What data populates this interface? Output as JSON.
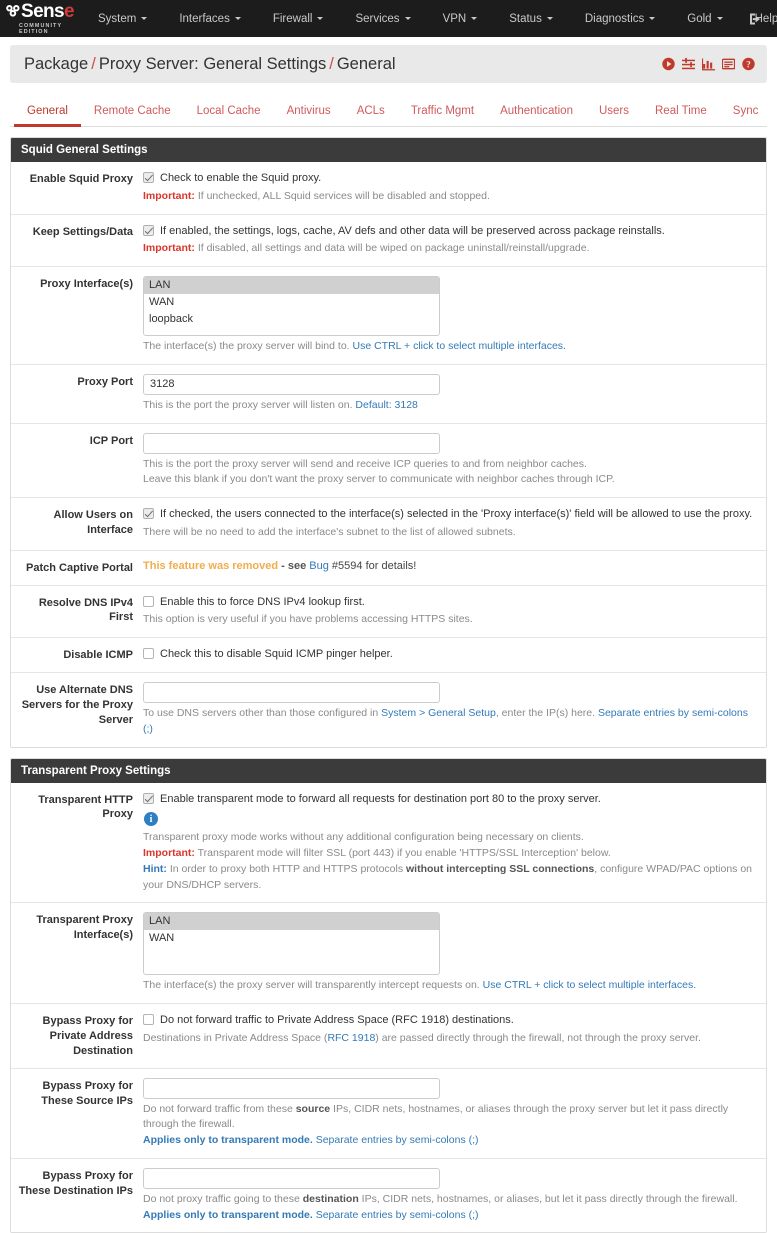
{
  "brand": {
    "name_pf": "pf",
    "name_sens": "Sens",
    "name_e": "e",
    "subtitle": "COMMUNITY EDITION"
  },
  "navbar": {
    "items": [
      {
        "label": "System",
        "has_caret": true
      },
      {
        "label": "Interfaces",
        "has_caret": true
      },
      {
        "label": "Firewall",
        "has_caret": true
      },
      {
        "label": "Services",
        "has_caret": true
      },
      {
        "label": "VPN",
        "has_caret": true
      },
      {
        "label": "Status",
        "has_caret": true
      },
      {
        "label": "Diagnostics",
        "has_caret": true
      },
      {
        "label": "Gold",
        "has_caret": true
      },
      {
        "label": "Help",
        "has_caret": true
      }
    ],
    "logout_icon": "logout-icon"
  },
  "breadcrumb": {
    "part1": "Package",
    "part2": "Proxy Server: General Settings",
    "part3": "General",
    "sep": "/",
    "icons": [
      "play-icon",
      "sliders-icon",
      "chart-icon",
      "log-icon",
      "help-icon"
    ]
  },
  "tabs": [
    {
      "label": "General",
      "active": true
    },
    {
      "label": "Remote Cache",
      "active": false
    },
    {
      "label": "Local Cache",
      "active": false
    },
    {
      "label": "Antivirus",
      "active": false
    },
    {
      "label": "ACLs",
      "active": false
    },
    {
      "label": "Traffic Mgmt",
      "active": false
    },
    {
      "label": "Authentication",
      "active": false
    },
    {
      "label": "Users",
      "active": false
    },
    {
      "label": "Real Time",
      "active": false
    },
    {
      "label": "Sync",
      "active": false
    }
  ],
  "squid_general": {
    "title": "Squid General Settings",
    "enable_squid": {
      "label": "Enable Squid Proxy",
      "checkbox_text": "Check to enable the Squid proxy.",
      "checked": true,
      "important_label": "Important:",
      "important_text": " If unchecked, ALL Squid services will be disabled and stopped."
    },
    "keep_settings": {
      "label": "Keep Settings/Data",
      "checkbox_text": "If enabled, the settings, logs, cache, AV defs and other data will be preserved across package reinstalls.",
      "checked": true,
      "important_label": "Important:",
      "important_text": " If disabled, all settings and data will be wiped on package uninstall/reinstall/upgrade."
    },
    "proxy_interfaces": {
      "label": "Proxy Interface(s)",
      "options": [
        {
          "value": "LAN",
          "selected": true
        },
        {
          "value": "WAN",
          "selected": false
        },
        {
          "value": "loopback",
          "selected": false
        }
      ],
      "help_text": "The interface(s) the proxy server will bind to. ",
      "help_link": "Use CTRL + click to select multiple interfaces."
    },
    "proxy_port": {
      "label": "Proxy Port",
      "value": "3128",
      "placeholder": "",
      "help_text": "This is the port the proxy server will listen on. ",
      "help_link": "Default: 3128"
    },
    "icp_port": {
      "label": "ICP Port",
      "value": "",
      "placeholder": "",
      "help_line1": "This is the port the proxy server will send and receive ICP queries to and from neighbor caches.",
      "help_line2": "Leave this blank if you don't want the proxy server to communicate with neighbor caches through ICP."
    },
    "allow_users": {
      "label": "Allow Users on Interface",
      "checkbox_text": "If checked, the users connected to the interface(s) selected in the 'Proxy interface(s)' field will be allowed to use the proxy.",
      "checked": true,
      "help_text": "There will be no need to add the interface's subnet to the list of allowed subnets."
    },
    "patch_captive_portal": {
      "label": "Patch Captive Portal",
      "warning": "This feature was removed",
      "mid": " - see ",
      "link": "Bug",
      "tail": " #5594 for details!"
    },
    "resolve_dns_ipv4": {
      "label": "Resolve DNS IPv4 First",
      "checkbox_text": "Enable this to force DNS IPv4 lookup first.",
      "checked": false,
      "help_text": "This option is very useful if you have problems accessing HTTPS sites."
    },
    "disable_icmp": {
      "label": "Disable ICMP",
      "checkbox_text": "Check this to disable Squid ICMP pinger helper.",
      "checked": false
    },
    "alternate_dns": {
      "label": "Use Alternate DNS Servers for the Proxy Server",
      "value": "",
      "placeholder": "",
      "help_pre": "To use DNS servers other than those configured in ",
      "help_link1": "System > General Setup",
      "help_mid": ", enter the IP(s) here. ",
      "help_link2": "Separate entries by semi-colons (;)"
    }
  },
  "transparent_proxy": {
    "title": "Transparent Proxy Settings",
    "transparent_http": {
      "label": "Transparent HTTP Proxy",
      "checkbox_text": "Enable transparent mode to forward all requests for destination port 80 to the proxy server.",
      "checked": true,
      "info_icon": "info-icon",
      "help_line1": "Transparent proxy mode works without any additional configuration being necessary on clients.",
      "important_label": "Important:",
      "important_text": " Transparent mode will filter SSL (port 443) if you enable 'HTTPS/SSL Interception' below.",
      "hint_label": "Hint:",
      "hint_pre": " In order to proxy both HTTP and HTTPS protocols ",
      "hint_bold": "without intercepting SSL connections",
      "hint_post": ", configure WPAD/PAC options on your DNS/DHCP servers."
    },
    "transparent_interfaces": {
      "label": "Transparent Proxy Interface(s)",
      "options": [
        {
          "value": "LAN",
          "selected": true
        },
        {
          "value": "WAN",
          "selected": false
        }
      ],
      "help_text": "The interface(s) the proxy server will transparently intercept requests on. ",
      "help_link": "Use CTRL + click to select multiple interfaces."
    },
    "bypass_private": {
      "label": "Bypass Proxy for Private Address Destination",
      "checkbox_text": "Do not forward traffic to Private Address Space (RFC 1918) destinations.",
      "checked": false,
      "help_pre": "Destinations in Private Address Space (",
      "help_link": "RFC 1918",
      "help_post": ") are passed directly through the firewall, not through the proxy server."
    },
    "bypass_source_ips": {
      "label": "Bypass Proxy for These Source IPs",
      "value": "",
      "placeholder": "",
      "help_pre": "Do not forward traffic from these ",
      "help_bold": "source",
      "help_post": " IPs, CIDR nets, hostnames, or aliases through the proxy server but let it pass directly through the firewall.",
      "note_bold": "Applies only to transparent mode.",
      "note_link": " Separate entries by semi-colons (;)"
    },
    "bypass_dest_ips": {
      "label": "Bypass Proxy for These Destination IPs",
      "value": "",
      "placeholder": "",
      "help_pre": "Do not proxy traffic going to these ",
      "help_bold": "destination",
      "help_post": " IPs, CIDR nets, hostnames, or aliases, but let it pass directly through the firewall.",
      "note_bold": "Applies only to transparent mode.",
      "note_link": " Separate entries by semi-colons (;)"
    }
  }
}
